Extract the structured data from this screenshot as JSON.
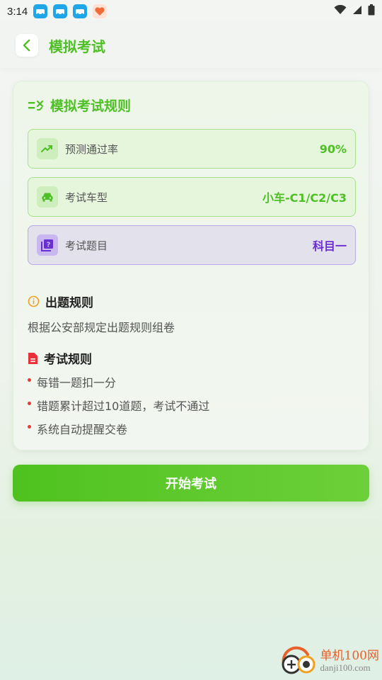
{
  "status_bar": {
    "time": "3:14"
  },
  "header": {
    "title": "模拟考试",
    "back_icon": "chevron-left-icon"
  },
  "rules_card": {
    "title": "模拟考试规则",
    "rows": [
      {
        "icon": "trending-up-icon",
        "label": "预测通过率",
        "value": "90%"
      },
      {
        "icon": "car-icon",
        "label": "考试车型",
        "value": "小车-C1/C2/C3"
      },
      {
        "icon": "question-book-icon",
        "label": "考试题目",
        "value": "科目一"
      }
    ],
    "question_rules": {
      "title": "出题规则",
      "text": "根据公安部规定出题规则组卷"
    },
    "exam_rules": {
      "title": "考试规则",
      "items": [
        "每错一题扣一分",
        "错题累计超过10道题，考试不通过",
        "系统自动提醒交卷"
      ]
    }
  },
  "actions": {
    "start_label": "开始考试"
  },
  "watermark": {
    "cn": "单机100网",
    "en": "danji100.com"
  },
  "colors": {
    "accent_green": "#4fbf26",
    "accent_purple": "#6a2fd0",
    "rule_dot": "#e83a3a",
    "info_orange": "#f0a020",
    "doc_red": "#e8303a"
  }
}
